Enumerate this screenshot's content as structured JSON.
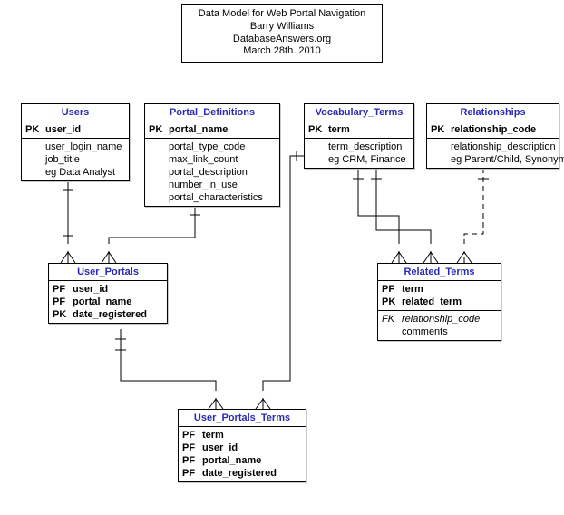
{
  "title": {
    "line1": "Data Model for Web Portal Navigation",
    "line2": "Barry Williams",
    "line3": "DatabaseAnswers.org",
    "line4": "March 28th. 2010"
  },
  "entities": {
    "users": {
      "name": "Users",
      "rows": [
        {
          "key": "PK",
          "attr": "user_id",
          "pk": true
        },
        {
          "key": "",
          "attr": "user_login_name"
        },
        {
          "key": "",
          "attr": "job_title"
        },
        {
          "key": "",
          "attr": "eg Data Analyst"
        }
      ]
    },
    "portal_def": {
      "name": "Portal_Definitions",
      "rows": [
        {
          "key": "PK",
          "attr": "portal_name",
          "pk": true
        },
        {
          "key": "",
          "attr": "portal_type_code"
        },
        {
          "key": "",
          "attr": "max_link_count"
        },
        {
          "key": "",
          "attr": "portal_description"
        },
        {
          "key": "",
          "attr": "number_in_use"
        },
        {
          "key": "",
          "attr": "portal_characteristics"
        }
      ]
    },
    "vocab": {
      "name": "Vocabulary_Terms",
      "rows": [
        {
          "key": "PK",
          "attr": "term",
          "pk": true
        },
        {
          "key": "",
          "attr": "term_description"
        },
        {
          "key": "",
          "attr": "eg CRM, Finance"
        }
      ]
    },
    "relationships": {
      "name": "Relationships",
      "rows": [
        {
          "key": "PK",
          "attr": "relationship_code",
          "pk": true
        },
        {
          "key": "",
          "attr": "relationship_description"
        },
        {
          "key": "",
          "attr": "eg Parent/Child, Synonym"
        }
      ]
    },
    "user_portals": {
      "name": "User_Portals",
      "rows": [
        {
          "key": "PF",
          "attr": "user_id",
          "pk": true
        },
        {
          "key": "PF",
          "attr": "portal_name",
          "pk": true
        },
        {
          "key": "PK",
          "attr": "date_registered",
          "pk": true
        }
      ]
    },
    "related_terms": {
      "name": "Related_Terms",
      "rows": [
        {
          "key": "PF",
          "attr": "term",
          "pk": true
        },
        {
          "key": "PK",
          "attr": "related_term",
          "pk": true
        },
        {
          "key": "FK",
          "attr": "relationship_code",
          "fk": true
        },
        {
          "key": "",
          "attr": "comments"
        }
      ]
    },
    "upt": {
      "name": "User_Portals_Terms",
      "rows": [
        {
          "key": "PF",
          "attr": "term",
          "pk": true
        },
        {
          "key": "PF",
          "attr": "user_id",
          "pk": true
        },
        {
          "key": "PF",
          "attr": "portal_name",
          "pk": true
        },
        {
          "key": "PF",
          "attr": "date_registered",
          "pk": true
        }
      ]
    }
  }
}
